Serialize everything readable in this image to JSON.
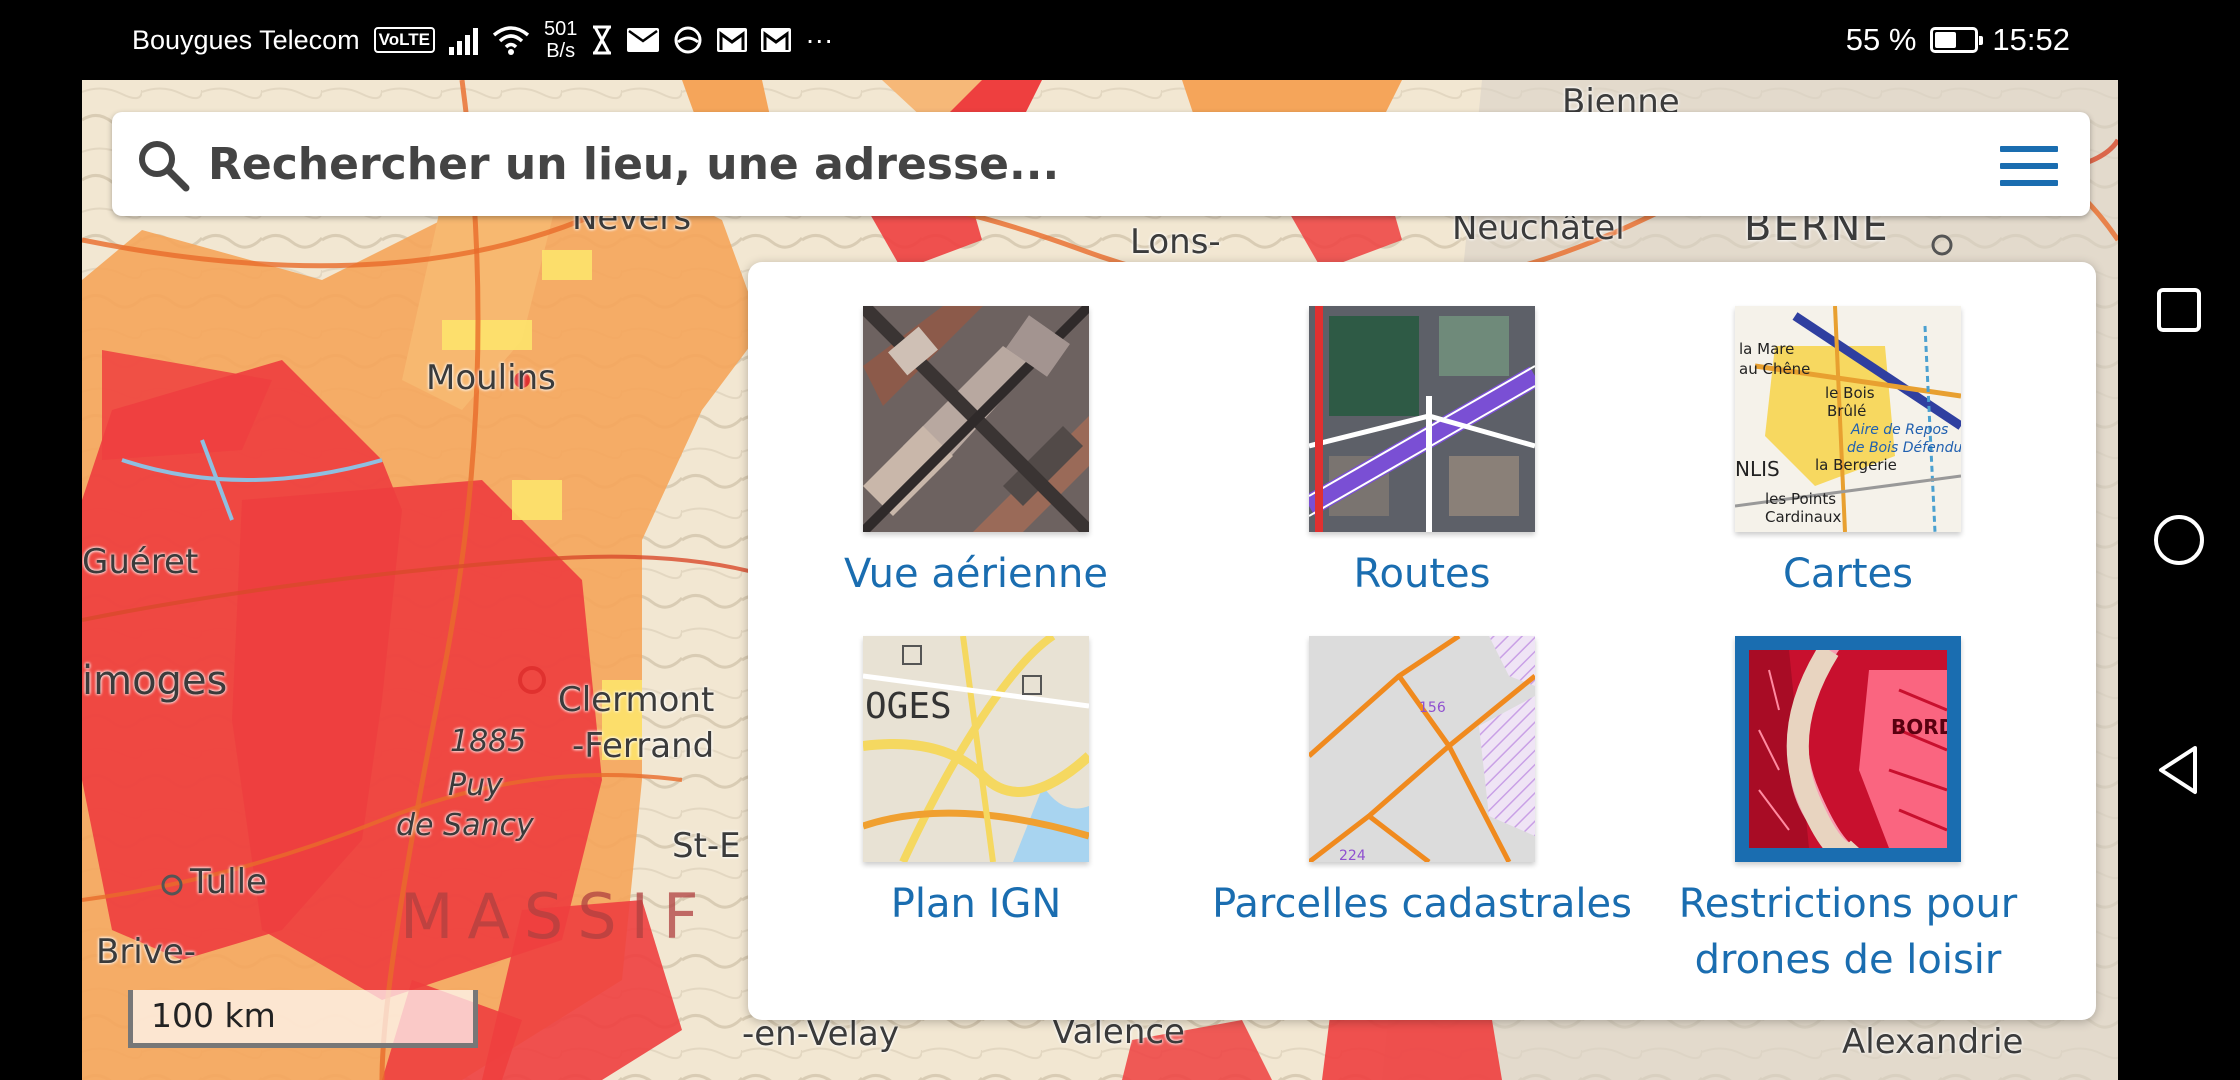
{
  "status_bar": {
    "carrier": "Bouygues Telecom",
    "volte": "VoLTE",
    "net_speed_value": "501",
    "net_speed_unit": "B/s",
    "more": "···",
    "battery_percent": "55 %",
    "battery_level": 0.55,
    "time": "15:52",
    "icons": [
      "signal-icon",
      "wifi-icon",
      "hourglass-icon",
      "mail-icon",
      "sync-icon",
      "gmail-icon",
      "gmail-icon"
    ]
  },
  "search": {
    "placeholder": "Rechercher un lieu, une adresse..."
  },
  "layers": [
    {
      "label": "Vue aérienne",
      "selected": false
    },
    {
      "label": "Routes",
      "selected": false
    },
    {
      "label": "Cartes",
      "selected": false
    },
    {
      "label": "Plan IGN",
      "selected": false
    },
    {
      "label": "Parcelles cadastrales",
      "selected": false
    },
    {
      "label": "Restrictions pour drones de loisir",
      "selected": true
    }
  ],
  "thumb_text": {
    "plan_ign": "OGES",
    "parcelles_a": "156",
    "parcelles_b": "224",
    "cartes_a": "la Mare",
    "cartes_b": "au Chêne",
    "cartes_c": "le Bois",
    "cartes_d": "Brûlé",
    "cartes_e": "Aire de Repos",
    "cartes_f": "de Bois Défendu",
    "cartes_g": "la Bergerie",
    "cartes_h": "les Points",
    "cartes_i": "Cardinaux",
    "cartes_j": "NLIS",
    "drones": "BORD"
  },
  "map": {
    "labels": {
      "bienne": "Bienne",
      "neuchatel": "Neuchâtel",
      "berne": "BERNE",
      "lons": "Lons-",
      "nevers": "Nevers",
      "moulins": "Moulins",
      "gueret": "Guéret",
      "limoges": "imoges",
      "clermont": "Clermont",
      "ferrand": "-Ferrand",
      "altitude": "1885",
      "puy": "Puy",
      "sancy": "de Sancy",
      "tulle": "Tulle",
      "brive": "Brive-",
      "massif": "MASSIF",
      "st": "St-E",
      "velay": "-en-Velay",
      "valence": "Valence",
      "alexandrie": "Alexandrie"
    }
  },
  "scale": {
    "label": "100 km"
  },
  "colors": {
    "accent": "#1a6db0",
    "restriction_red": "#ee3f3f",
    "restriction_orange": "#f5a55a"
  }
}
